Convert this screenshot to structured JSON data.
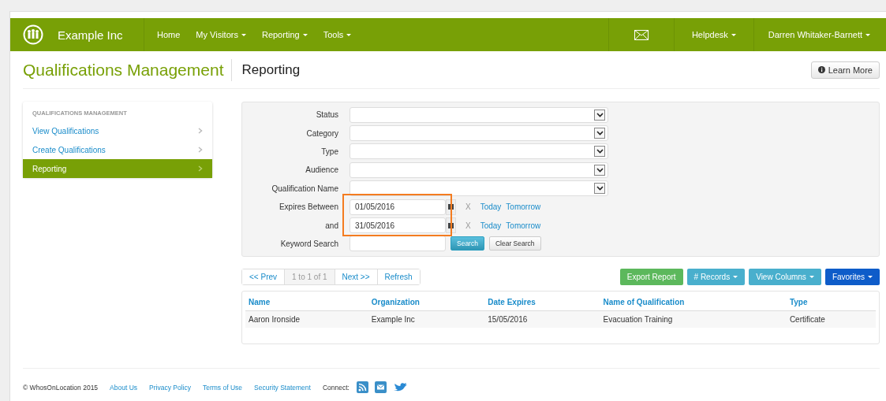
{
  "navbar": {
    "brand": "Example Inc",
    "menu": [
      {
        "label": "Home",
        "dropdown": false
      },
      {
        "label": "My Visitors",
        "dropdown": true
      },
      {
        "label": "Reporting",
        "dropdown": true
      },
      {
        "label": "Tools",
        "dropdown": true
      }
    ],
    "right_menu": [
      {
        "label": "Helpdesk",
        "dropdown": true
      },
      {
        "label": "Darren Whitaker-Barnett",
        "dropdown": true
      }
    ]
  },
  "header": {
    "title": "Qualifications Management",
    "subtitle": "Reporting",
    "learn_more": "Learn More"
  },
  "sidebar": {
    "heading": "QUALIFICATIONS MANAGEMENT",
    "items": [
      {
        "label": "View Qualifications",
        "selected": false
      },
      {
        "label": "Create Qualifications",
        "selected": false
      },
      {
        "label": "Reporting",
        "selected": true
      }
    ]
  },
  "filters": {
    "date_fields_highlighted": true,
    "rows": [
      {
        "kind": "select",
        "label": "Status"
      },
      {
        "kind": "select",
        "label": "Category"
      },
      {
        "kind": "select",
        "label": "Type"
      },
      {
        "kind": "select",
        "label": "Audience"
      },
      {
        "kind": "select",
        "label": "Qualification Name"
      },
      {
        "kind": "date",
        "label": "Expires Between",
        "value": "01/05/2016",
        "clear": "X",
        "today": "Today",
        "tomorrow": "Tomorrow"
      },
      {
        "kind": "date",
        "label": "and",
        "value": "31/05/2016",
        "clear": "X",
        "today": "Today",
        "tomorrow": "Tomorrow"
      },
      {
        "kind": "keyword",
        "label": "Keyword Search",
        "search": "Search",
        "clear_search": "Clear Search"
      }
    ]
  },
  "pager": {
    "prev": "<< Prev",
    "range": "1 to 1 of 1",
    "next": "Next >>",
    "refresh": "Refresh"
  },
  "actions": [
    {
      "label": "Export Report",
      "kind": "success",
      "dropdown": false
    },
    {
      "label": "# Records",
      "kind": "info",
      "dropdown": true
    },
    {
      "label": "View Columns",
      "kind": "info",
      "dropdown": true
    },
    {
      "label": "Favorites",
      "kind": "primary",
      "dropdown": true
    }
  ],
  "table": {
    "columns": [
      "Name",
      "Organization",
      "Date Expires",
      "Name of Qualification",
      "Type"
    ],
    "rows": [
      [
        "Aaron Ironside",
        "Example Inc",
        "15/05/2016",
        "Evacuation Training",
        "Certificate"
      ]
    ]
  },
  "footer": {
    "copyright": "© WhosOnLocation 2015",
    "links": [
      "About Us",
      "Privacy Policy",
      "Terms of Use",
      "Security Statement"
    ],
    "connect": "Connect:"
  }
}
